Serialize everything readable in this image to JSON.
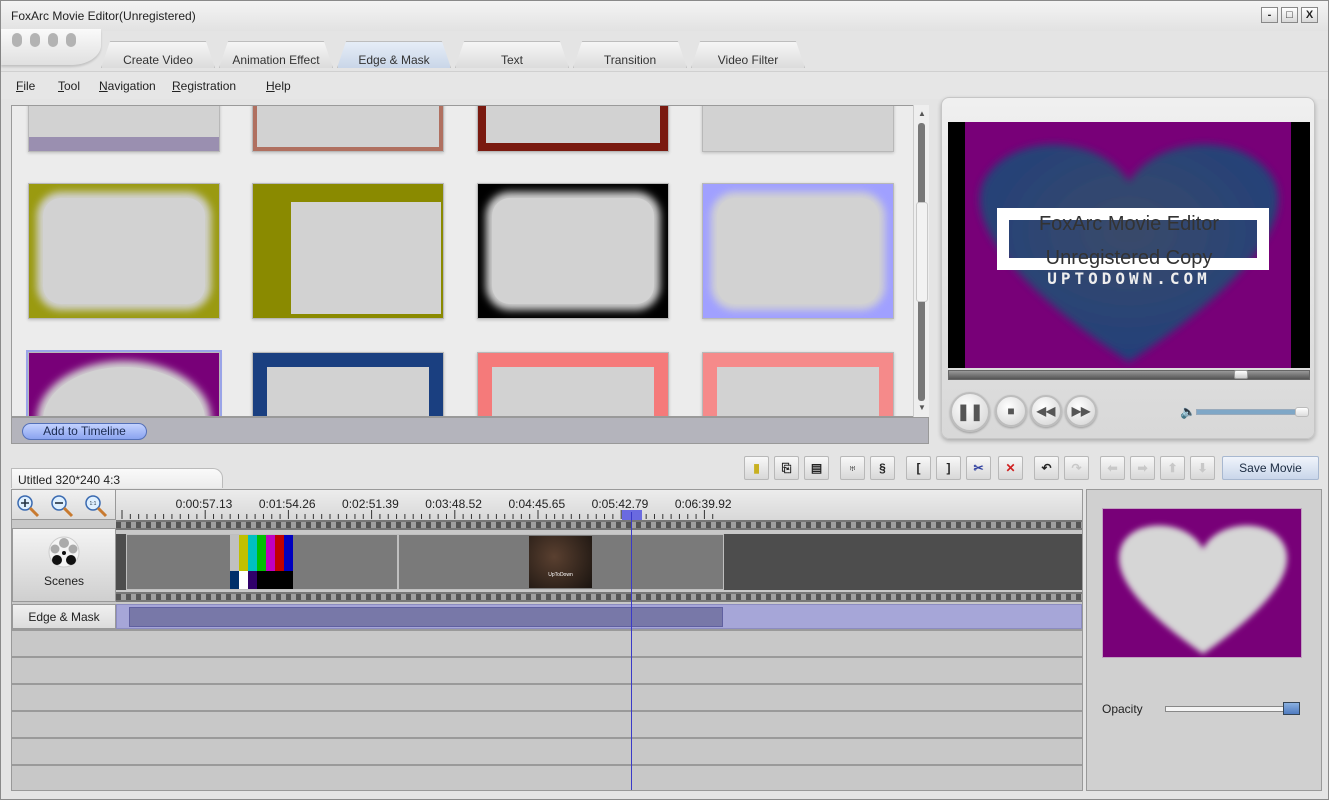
{
  "window": {
    "title": "FoxArc Movie Editor(Unregistered)",
    "controls": {
      "minimize": "-",
      "maximize": "□",
      "close": "X"
    }
  },
  "tabs": [
    {
      "label": "Create Video",
      "active": false
    },
    {
      "label": "Animation Effect",
      "active": false
    },
    {
      "label": "Edge & Mask",
      "active": true
    },
    {
      "label": "Text",
      "active": false
    },
    {
      "label": "Transition",
      "active": false
    },
    {
      "label": "Video Filter",
      "active": false
    }
  ],
  "menu": [
    {
      "label": "File",
      "accel": "F"
    },
    {
      "label": "Tool",
      "accel": "T"
    },
    {
      "label": "Navigation",
      "accel": "N"
    },
    {
      "label": "Registration",
      "accel": "R"
    },
    {
      "label": "Help",
      "accel": "H"
    }
  ],
  "gallery": {
    "items": [
      {
        "name": "gradient-bottom-frame",
        "color": "#9a8fb0"
      },
      {
        "name": "brown-thin-frame",
        "color": "#b07060"
      },
      {
        "name": "red-ornate-frame",
        "color": "#7a1a10"
      },
      {
        "name": "film-strip-frame",
        "color": "#cfcfcf"
      },
      {
        "name": "olive-scratch-frame",
        "color": "#9a9a10"
      },
      {
        "name": "olive-music-frame",
        "color": "#8a8a00"
      },
      {
        "name": "black-scroll-frame",
        "color": "#000000"
      },
      {
        "name": "lavender-cloud-frame",
        "color": "#a0a0ff"
      },
      {
        "name": "purple-heart-frame",
        "color": "#780078",
        "selected": true
      },
      {
        "name": "blue-stars-frame",
        "color": "#1a3f80"
      },
      {
        "name": "pink-hearts-frame",
        "color": "#f57a7a"
      },
      {
        "name": "pink-floral-frame",
        "color": "#f58a8a"
      }
    ],
    "add_button": "Add to Timeline"
  },
  "player": {
    "overlay_line1": "FoxArc Movie Editor",
    "overlay_line2": "Unregistered Copy",
    "watermark": "UPTODOWN.COM",
    "seek_fraction": 0.82,
    "volume_fraction": 1.0,
    "buttons": [
      "pause",
      "stop",
      "rewind",
      "fast-forward"
    ]
  },
  "project": {
    "tab_label": "Utitled 320*240 4:3"
  },
  "toolbar": {
    "save_label": "Save Movie",
    "buttons": [
      {
        "name": "film-icon",
        "glyph": "▮",
        "enabled": true
      },
      {
        "name": "import-icon",
        "glyph": "⎘",
        "enabled": true
      },
      {
        "name": "save-project-icon",
        "glyph": "▤",
        "enabled": true
      },
      {
        "name": "split-audio-icon",
        "glyph": "♅",
        "enabled": true
      },
      {
        "name": "record-icon",
        "glyph": "§",
        "enabled": true
      },
      {
        "name": "mark-in-icon",
        "glyph": "[",
        "enabled": true
      },
      {
        "name": "mark-out-icon",
        "glyph": "]",
        "enabled": true
      },
      {
        "name": "cut-icon",
        "glyph": "✂",
        "enabled": true
      },
      {
        "name": "delete-icon",
        "glyph": "✕",
        "enabled": true
      },
      {
        "name": "undo-icon",
        "glyph": "↶",
        "enabled": true
      },
      {
        "name": "redo-icon",
        "glyph": "↷",
        "enabled": false
      },
      {
        "name": "move-left-icon",
        "glyph": "⬅",
        "enabled": false
      },
      {
        "name": "move-right-icon",
        "glyph": "➡",
        "enabled": false
      },
      {
        "name": "move-up-icon",
        "glyph": "⬆",
        "enabled": false
      },
      {
        "name": "move-down-icon",
        "glyph": "⬇",
        "enabled": false
      }
    ]
  },
  "timeline": {
    "zoom_in": "zoom-in",
    "zoom_out": "zoom-out",
    "zoom_fit": "zoom-fit",
    "ruler_labels": [
      "0:00:57.13",
      "0:01:54.26",
      "0:02:51.39",
      "0:03:48.52",
      "0:04:45.65",
      "0:05:42.79",
      "0:06:39.92"
    ],
    "playhead_time": "0:06:00",
    "tracks": {
      "scenes_label": "Scenes",
      "edge_mask_label": "Edge & Mask"
    },
    "clips": [
      {
        "name": "color-bars-clip",
        "thumb": "color-bars"
      },
      {
        "name": "uptodown-clip",
        "thumb": "uptodown",
        "thumb_text": "UpToDown"
      }
    ]
  },
  "properties": {
    "opacity_label": "Opacity",
    "opacity_fraction": 1.0,
    "preview_color": "#780078"
  }
}
